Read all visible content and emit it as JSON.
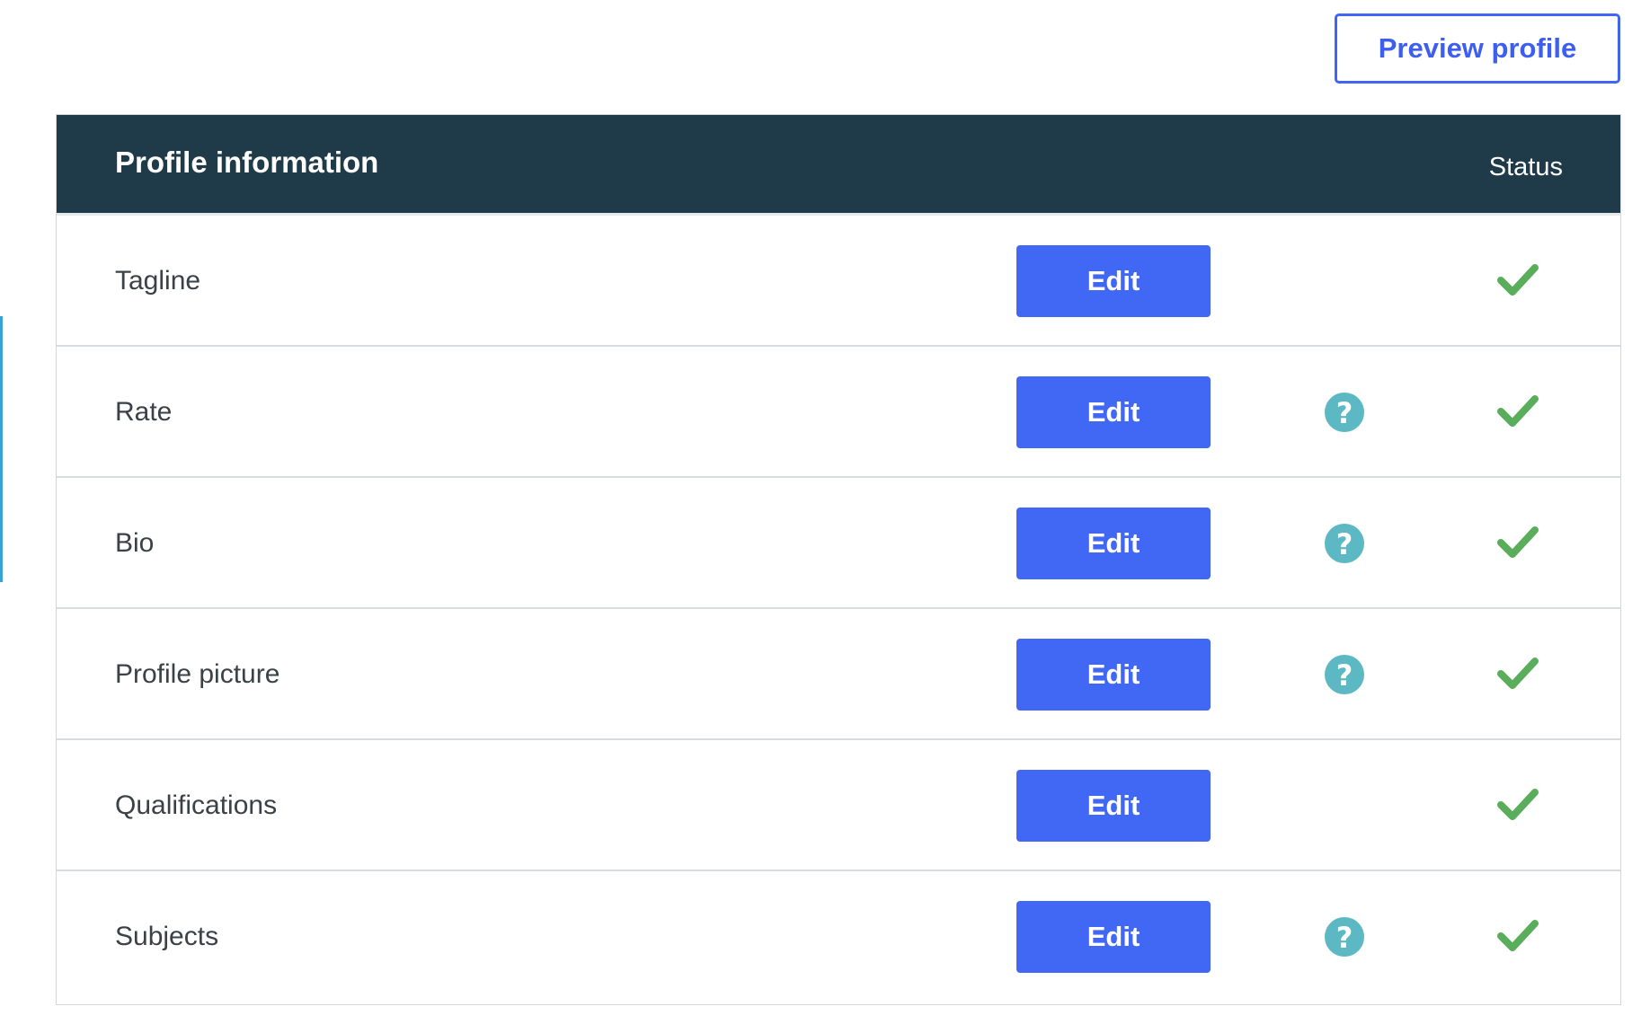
{
  "header_actions": {
    "preview_label": "Preview profile"
  },
  "panel": {
    "title": "Profile information",
    "status_label": "Status",
    "rows": [
      {
        "label": "Tagline",
        "edit_label": "Edit",
        "has_help": false,
        "status": "complete"
      },
      {
        "label": "Rate",
        "edit_label": "Edit",
        "has_help": true,
        "status": "complete"
      },
      {
        "label": "Bio",
        "edit_label": "Edit",
        "has_help": true,
        "status": "complete"
      },
      {
        "label": "Profile picture",
        "edit_label": "Edit",
        "has_help": true,
        "status": "complete"
      },
      {
        "label": "Qualifications",
        "edit_label": "Edit",
        "has_help": false,
        "status": "complete"
      },
      {
        "label": "Subjects",
        "edit_label": "Edit",
        "has_help": true,
        "status": "complete"
      }
    ]
  },
  "icons": {
    "help": "question-mark-icon",
    "status_complete": "checkmark-icon"
  },
  "colors": {
    "header_bg": "#1f3b49",
    "primary_button": "#4167f5",
    "help_icon": "#5cb8c2",
    "check": "#5aad5a"
  }
}
